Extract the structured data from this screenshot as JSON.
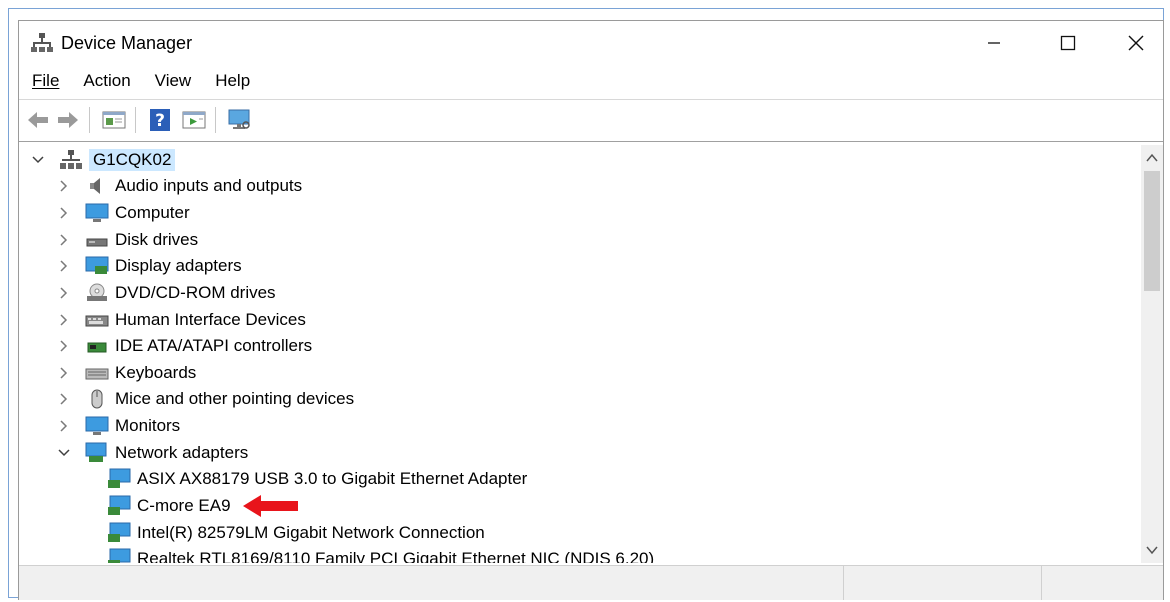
{
  "window": {
    "title": "Device Manager"
  },
  "menu": {
    "file": "File",
    "action": "Action",
    "view": "View",
    "help": "Help"
  },
  "tree": {
    "root": "G1CQK02",
    "categories": [
      "Audio inputs and outputs",
      "Computer",
      "Disk drives",
      "Display adapters",
      "DVD/CD-ROM drives",
      "Human Interface Devices",
      "IDE ATA/ATAPI controllers",
      "Keyboards",
      "Mice and other pointing devices",
      "Monitors",
      "Network adapters"
    ],
    "network_adapters": [
      "ASIX AX88179 USB 3.0 to Gigabit Ethernet Adapter",
      "C-more EA9",
      "Intel(R) 82579LM Gigabit Network Connection",
      "Realtek RTL8169/8110 Family PCI Gigabit Ethernet NIC (NDIS 6.20)"
    ]
  },
  "colors": {
    "selection": "#cce8ff",
    "annotation_arrow": "#e8141b",
    "monitor_blue": "#2a8ad8"
  }
}
